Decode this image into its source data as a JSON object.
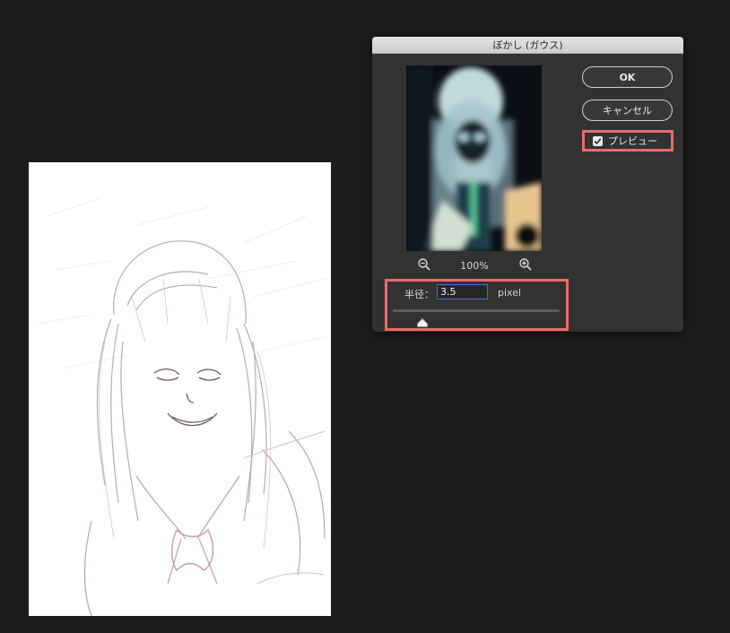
{
  "dialog": {
    "title": "ぼかし (ガウス)",
    "ok_label": "OK",
    "cancel_label": "キャンセル",
    "preview_label": "プレビュー",
    "preview_checked": true,
    "zoom_level": "100%",
    "zoom_out_icon": "zoom-out-icon",
    "zoom_in_icon": "zoom-in-icon"
  },
  "radius": {
    "label": "半径：",
    "value": "3.5",
    "unit": "pixel",
    "slider_fraction": 0.18
  },
  "colors": {
    "highlight_border": "#ea6b6b",
    "input_focus": "#3f6fd6",
    "background": "#1c1c1c",
    "dialog_bg": "#323232"
  }
}
